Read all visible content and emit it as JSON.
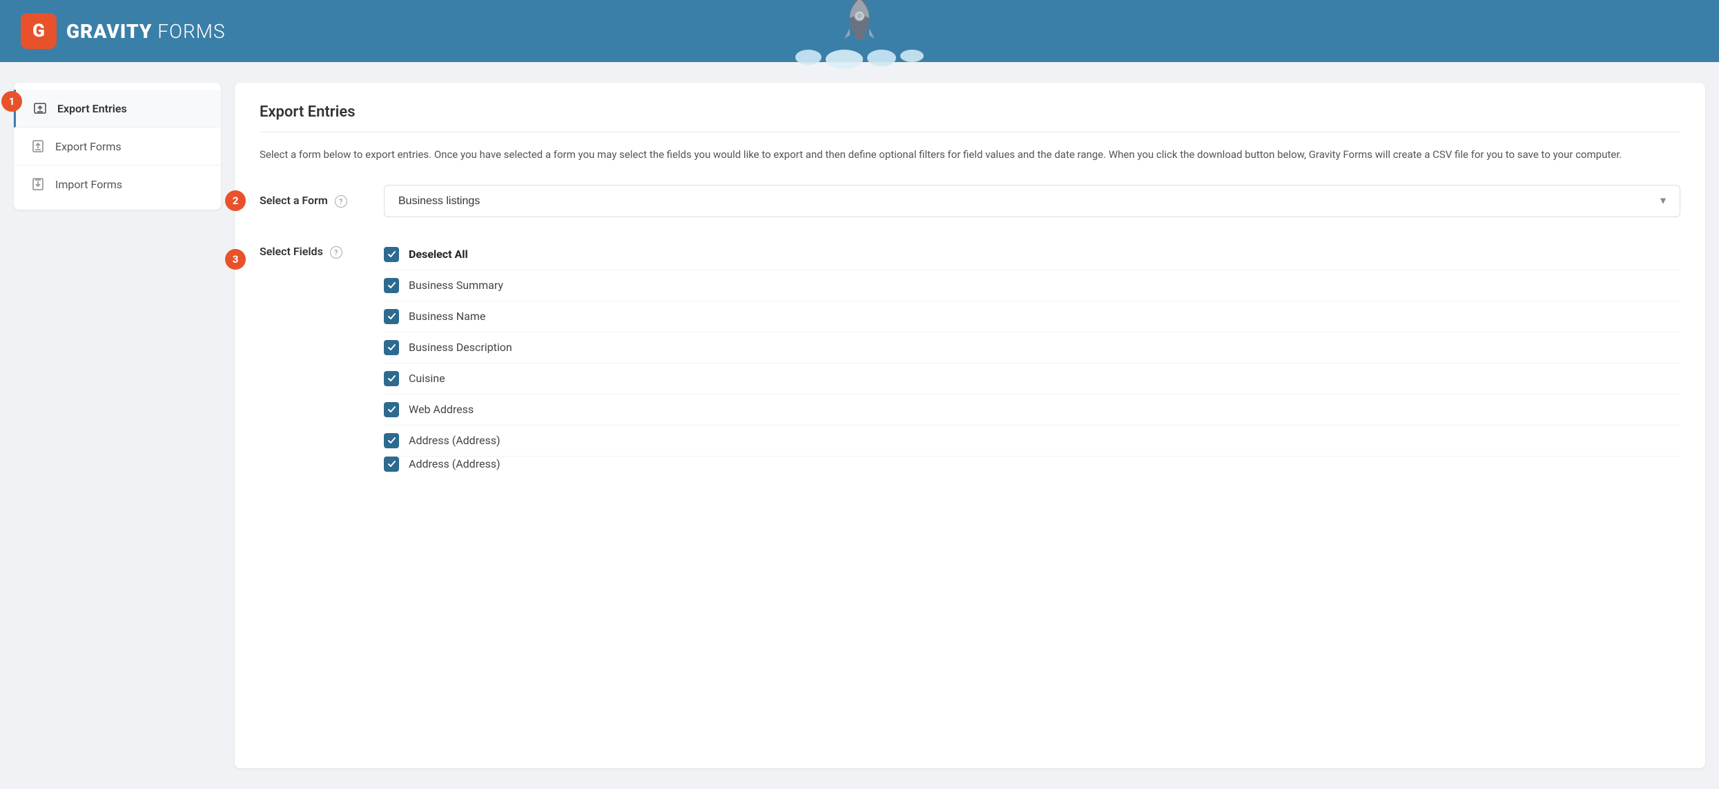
{
  "header": {
    "logo_letter": "G",
    "logo_bold": "GRAVITY",
    "logo_light": " FORMS"
  },
  "sidebar": {
    "items": [
      {
        "id": "export-entries",
        "label": "Export Entries",
        "icon": "export-entries-icon",
        "active": true
      },
      {
        "id": "export-forms",
        "label": "Export Forms",
        "icon": "export-forms-icon",
        "active": false
      },
      {
        "id": "import-forms",
        "label": "Import Forms",
        "icon": "import-forms-icon",
        "active": false
      }
    ]
  },
  "content": {
    "title": "Export Entries",
    "description": "Select a form below to export entries. Once you have selected a form you may select the fields you would like to export and then define optional filters for field values and the date range. When you click the download button below, Gravity Forms will create a CSV file for you to save to your computer.",
    "select_form_label": "Select a Form",
    "select_form_value": "Business listings",
    "select_fields_label": "Select Fields",
    "fields": [
      {
        "id": "deselect-all",
        "label": "Deselect All",
        "bold": true,
        "checked": true
      },
      {
        "id": "business-summary",
        "label": "Business Summary",
        "bold": false,
        "checked": true
      },
      {
        "id": "business-name",
        "label": "Business Name",
        "bold": false,
        "checked": true
      },
      {
        "id": "business-description",
        "label": "Business Description",
        "bold": false,
        "checked": true
      },
      {
        "id": "cuisine",
        "label": "Cuisine",
        "bold": false,
        "checked": true
      },
      {
        "id": "web-address",
        "label": "Web Address",
        "bold": false,
        "checked": true
      },
      {
        "id": "address-1",
        "label": "Address (Address)",
        "bold": false,
        "checked": true
      },
      {
        "id": "address-2",
        "label": "Address (Address)",
        "bold": false,
        "checked": true
      }
    ]
  },
  "steps": {
    "s1": "1",
    "s2": "2",
    "s3": "3"
  }
}
